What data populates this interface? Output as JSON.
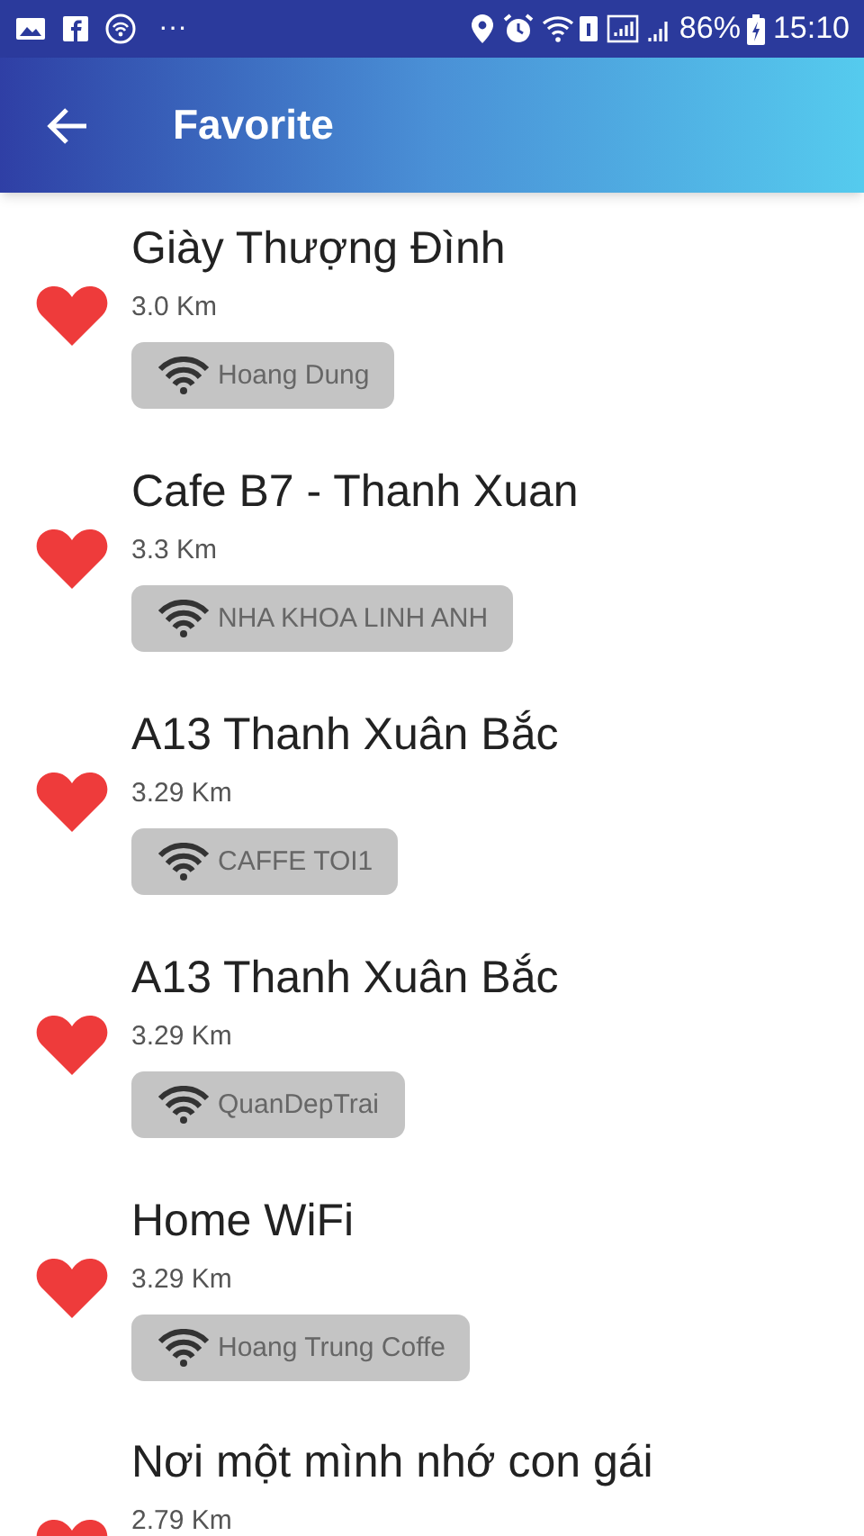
{
  "status_bar": {
    "battery": "86%",
    "time": "15:10",
    "more": "···"
  },
  "header": {
    "title": "Favorite"
  },
  "places": [
    {
      "name": "Giày Thượng Đình",
      "distance": "3.0 Km",
      "wifi": "Hoang Dung",
      "favorite": true
    },
    {
      "name": "Cafe B7 - Thanh Xuan",
      "distance": "3.3 Km",
      "wifi": "NHA KHOA LINH ANH",
      "favorite": true
    },
    {
      "name": "A13 Thanh Xuân Bắc",
      "distance": "3.29 Km",
      "wifi": "CAFFE TOI1",
      "favorite": true
    },
    {
      "name": "A13 Thanh Xuân Bắc",
      "distance": "3.29 Km",
      "wifi": "QuanDepTrai",
      "favorite": true
    },
    {
      "name": "Home WiFi",
      "distance": "3.29 Km",
      "wifi": "Hoang Trung Coffe",
      "favorite": true
    },
    {
      "name": "Nơi một mình nhớ con gái",
      "distance": "2.79 Km",
      "favorite": true
    }
  ]
}
